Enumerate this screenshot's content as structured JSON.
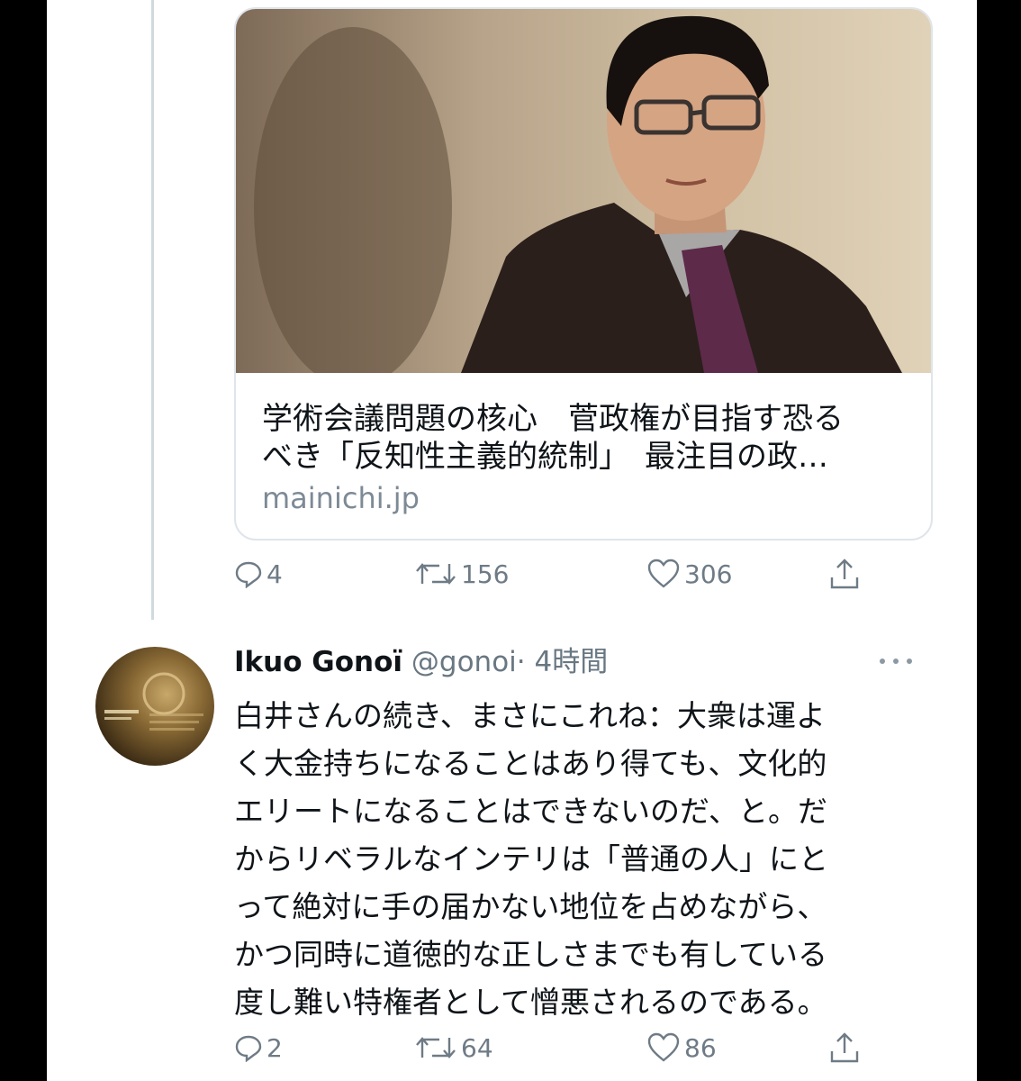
{
  "tweet1": {
    "card": {
      "title_lines": [
        "学術会議問題の核心　菅政権が目指す恐る",
        "べき「反知性主義的統制」　最注目の政…"
      ],
      "domain": "mainichi.jp"
    },
    "actions": {
      "replies": "4",
      "retweets": "156",
      "likes": "306"
    }
  },
  "tweet2": {
    "name": "Ikuo Gonoï",
    "handle": "@gonoi",
    "time": "· 4時間",
    "body_lines": [
      "白井さんの続き、まさにこれね：大衆は運よ",
      "く大金持ちになることはあり得ても、文化的",
      "エリートになることはできないのだ、と。だ",
      "からリベラルなインテリは「普通の人」にと",
      "って絶対に手の届かない地位を占めながら、",
      "かつ同時に道徳的な正しさまでも有している",
      "度し難い特権者として憎悪されるのである。"
    ],
    "actions": {
      "replies": "2",
      "retweets": "64",
      "likes": "86"
    }
  },
  "icons": {
    "reply": "speech-bubble-icon",
    "retweet": "retweet-arrows-icon",
    "like": "heart-outline-icon",
    "share": "share-upload-icon",
    "more": "more-dots-icon"
  },
  "colors": {
    "text": "#0f1419",
    "muted": "#687782",
    "border": "#dfe5ea",
    "background": "#ffffff"
  }
}
